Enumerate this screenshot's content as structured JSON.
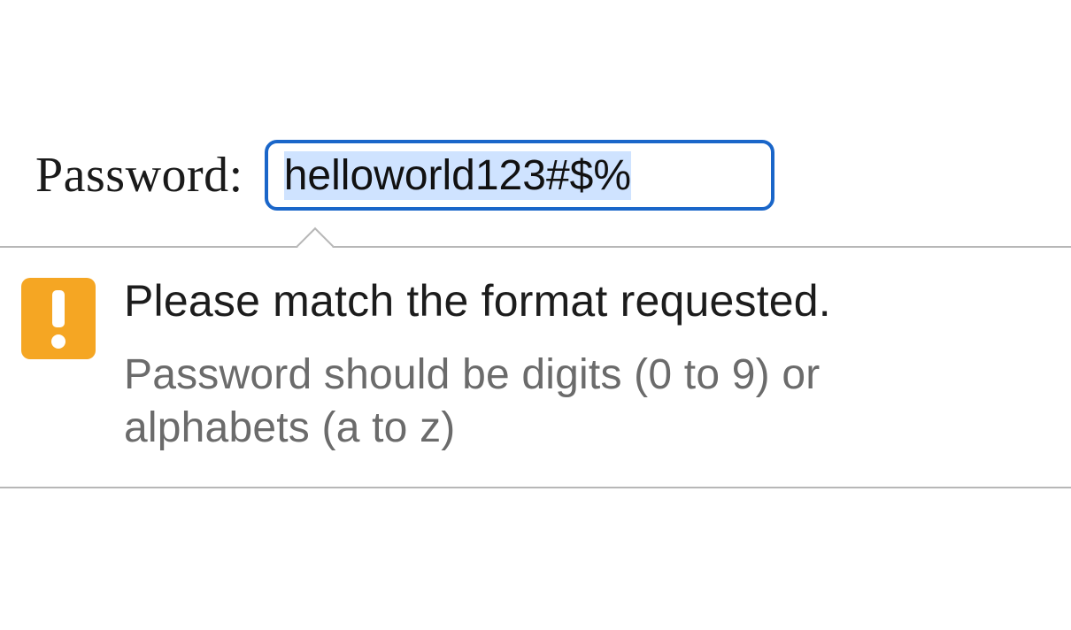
{
  "field": {
    "label": "Password:",
    "value": "helloworld123#$%",
    "placeholder": ""
  },
  "validation": {
    "title": "Please match the format requested.",
    "description": "Password should be digits (0 to 9) or alphabets (a to z)",
    "icon": "warning-icon"
  },
  "colors": {
    "focus_border": "#1a66c9",
    "warning_bg": "#f5a623",
    "tooltip_border": "#b7b7b7",
    "desc_text": "#6b6b6b"
  }
}
